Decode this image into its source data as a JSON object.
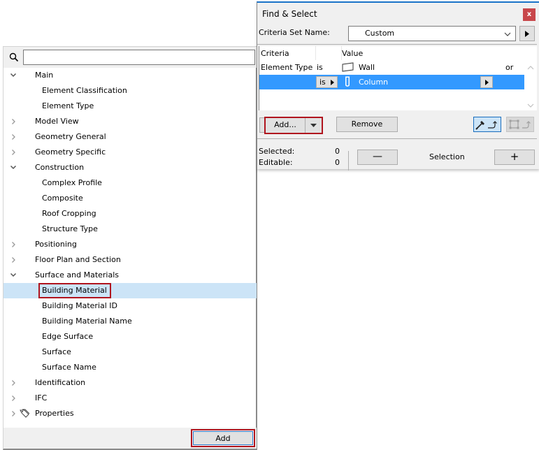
{
  "tree_panel": {
    "search": {
      "placeholder": "",
      "value": ""
    },
    "items": [
      {
        "label": "Main",
        "level": 0,
        "state": "expanded"
      },
      {
        "label": "Element Classification",
        "level": 1
      },
      {
        "label": "Element Type",
        "level": 1
      },
      {
        "label": "Model View",
        "level": 0,
        "state": "collapsed"
      },
      {
        "label": "Geometry General",
        "level": 0,
        "state": "collapsed"
      },
      {
        "label": "Geometry Specific",
        "level": 0,
        "state": "collapsed"
      },
      {
        "label": "Construction",
        "level": 0,
        "state": "expanded"
      },
      {
        "label": "Complex Profile",
        "level": 1
      },
      {
        "label": "Composite",
        "level": 1
      },
      {
        "label": "Roof Cropping",
        "level": 1
      },
      {
        "label": "Structure Type",
        "level": 1
      },
      {
        "label": "Positioning",
        "level": 0,
        "state": "collapsed"
      },
      {
        "label": "Floor Plan and Section",
        "level": 0,
        "state": "collapsed"
      },
      {
        "label": "Surface and Materials",
        "level": 0,
        "state": "expanded"
      },
      {
        "label": "Building Material",
        "level": 1,
        "selected": true,
        "highlighted": true
      },
      {
        "label": "Building Material ID",
        "level": 1
      },
      {
        "label": "Building Material Name",
        "level": 1
      },
      {
        "label": "Edge Surface",
        "level": 1
      },
      {
        "label": "Surface",
        "level": 1
      },
      {
        "label": "Surface Name",
        "level": 1
      },
      {
        "label": "Identification",
        "level": 0,
        "state": "collapsed"
      },
      {
        "label": "IFC",
        "level": 0,
        "state": "collapsed"
      },
      {
        "label": "Properties",
        "level": 0,
        "state": "collapsed",
        "icon": "tag-icon"
      }
    ],
    "add_label": "Add"
  },
  "dialog": {
    "title": "Find & Select",
    "close_label": "x",
    "criteria_set_label": "Criteria Set Name:",
    "criteria_set_value": "Custom",
    "table": {
      "headers": {
        "criteria": "Criteria",
        "value": "Value"
      },
      "rows": [
        {
          "criteria": "Element Type",
          "operator": "is",
          "value": "Wall",
          "value_icon": "wall-icon",
          "conjunction": "or",
          "selected": false
        },
        {
          "criteria": "",
          "operator": "is",
          "value": "Column",
          "value_icon": "column-icon",
          "conjunction": "",
          "selected": true
        }
      ]
    },
    "add_label": "Add...",
    "remove_label": "Remove",
    "selected_label": "Selected:",
    "selected_value": "0",
    "editable_label": "Editable:",
    "editable_value": "0",
    "minus_label": "—",
    "selection_label": "Selection",
    "plus_label": "+"
  },
  "colors": {
    "selection_blue": "#3399ff",
    "tree_selected": "#cce4f7",
    "highlight_red": "#b0141e",
    "close_red": "#c8474b"
  }
}
